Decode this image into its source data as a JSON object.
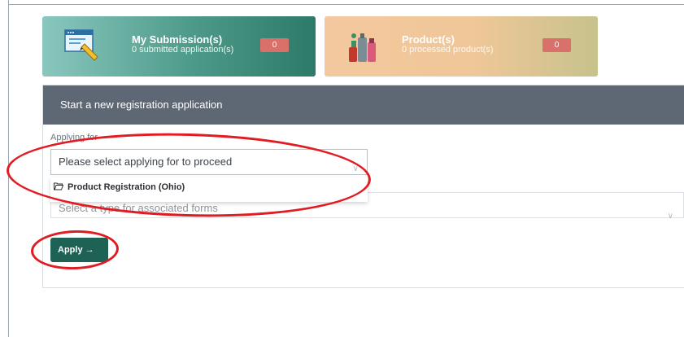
{
  "cards": {
    "submissions": {
      "title": "My Submission(s)",
      "subtitle": "0 submitted application(s)",
      "count": "0",
      "icon": "browser-edit-icon"
    },
    "products": {
      "title": "Product(s)",
      "subtitle": "0 processed product(s)",
      "count": "0",
      "icon": "products-icon"
    }
  },
  "panel": {
    "header": "Start a new registration application",
    "applying_label": "Applying for",
    "applying_placeholder": "Please select applying for to proceed",
    "dropdown_option": "Product Registration (Ohio)",
    "type_placeholder": "Select a type for associated forms",
    "apply_label": "Apply"
  },
  "colors": {
    "header": "#5e6874",
    "apply": "#1d6255",
    "badge": "#d9706a",
    "annotation": "#e11b22"
  }
}
